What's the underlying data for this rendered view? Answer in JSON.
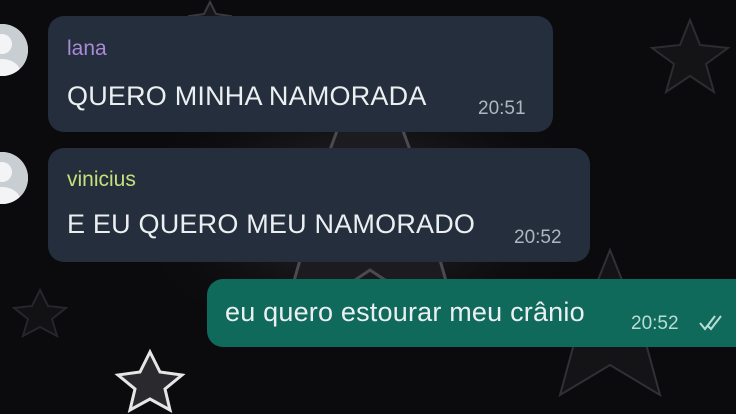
{
  "colors": {
    "incoming_bubble": "#242e3c",
    "outgoing_bubble": "#0f6a5c",
    "sender_lana": "#a98bd6",
    "sender_vinicius": "#c6e07a",
    "wallpaper": "#0b0b0d"
  },
  "messages": [
    {
      "sender": "lana",
      "text": "QUERO MINHA NAMORADA",
      "time": "20:51",
      "direction": "incoming",
      "avatar_icon": "default-avatar-icon"
    },
    {
      "sender": "vinicius",
      "text": "E EU QUERO MEU NAMORADO",
      "time": "20:52",
      "direction": "incoming",
      "avatar_icon": "default-avatar-icon"
    },
    {
      "text": "eu quero estourar meu crânio",
      "time": "20:52",
      "direction": "outgoing",
      "status_icon": "double-check-icon"
    }
  ]
}
